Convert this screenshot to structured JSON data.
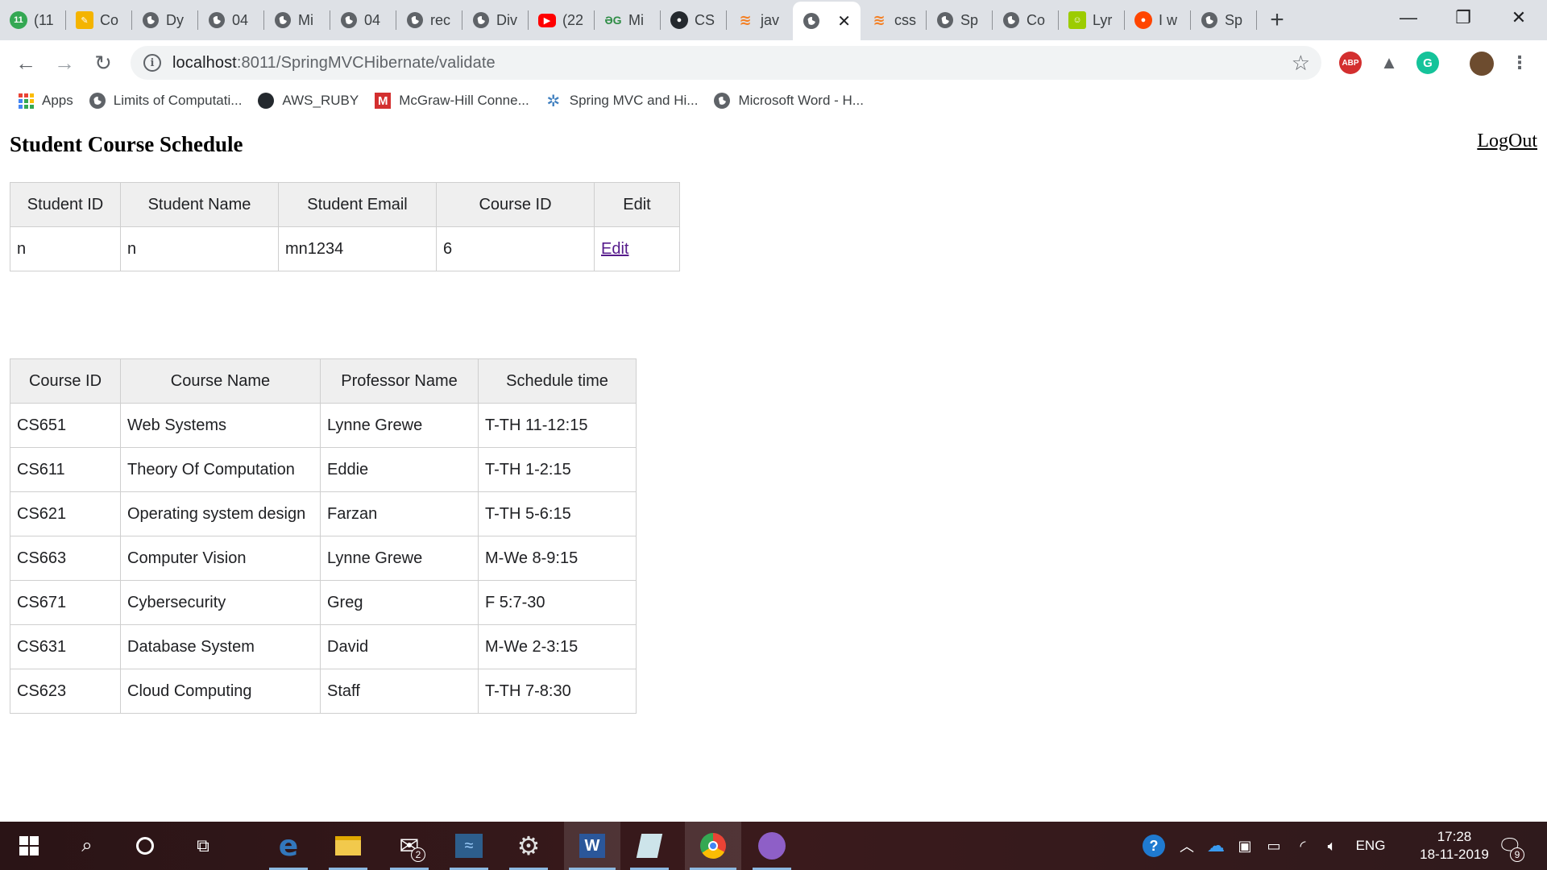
{
  "browser": {
    "tabs": [
      {
        "label": "(11",
        "icon": "counter-icon",
        "color": "#34a853"
      },
      {
        "label": "Co",
        "icon": "pencil-icon",
        "color": "#f4b400"
      },
      {
        "label": "Dy",
        "icon": "globe-icon",
        "color": "#5f6368"
      },
      {
        "label": "04",
        "icon": "globe-icon",
        "color": "#5f6368"
      },
      {
        "label": "Mi",
        "icon": "globe-icon",
        "color": "#5f6368"
      },
      {
        "label": "04",
        "icon": "globe-icon",
        "color": "#5f6368"
      },
      {
        "label": "rec",
        "icon": "globe-icon",
        "color": "#5f6368"
      },
      {
        "label": "Div",
        "icon": "globe-icon",
        "color": "#5f6368"
      },
      {
        "label": "(22",
        "icon": "youtube-icon",
        "color": "#ff0000"
      },
      {
        "label": "Mi",
        "icon": "gfg-icon",
        "color": "#2f8d46"
      },
      {
        "label": "CS",
        "icon": "github-icon",
        "color": "#24292e"
      },
      {
        "label": "jav",
        "icon": "stackoverflow-icon",
        "color": "#f48024"
      },
      {
        "label": "",
        "icon": "globe-icon",
        "color": "#5f6368",
        "active": true
      },
      {
        "label": "css",
        "icon": "stackoverflow-icon",
        "color": "#f48024"
      },
      {
        "label": "Sp",
        "icon": "globe-icon",
        "color": "#5f6368"
      },
      {
        "label": "Co",
        "icon": "globe-icon",
        "color": "#5f6368"
      },
      {
        "label": "Lyr",
        "icon": "lyrics-icon",
        "color": "#9ccc00"
      },
      {
        "label": "I w",
        "icon": "reddit-icon",
        "color": "#ff4500"
      },
      {
        "label": "Sp",
        "icon": "globe-icon",
        "color": "#5f6368"
      }
    ],
    "url_host": "localhost",
    "url_path": ":8011/SpringMVCHibernate/validate",
    "bookmarks": [
      {
        "label": "Apps",
        "icon": "apps-grid-icon"
      },
      {
        "label": "Limits of Computati...",
        "icon": "globe-icon"
      },
      {
        "label": "AWS_RUBY",
        "icon": "github-icon"
      },
      {
        "label": "McGraw-Hill Conne...",
        "icon": "mcgraw-hill-icon"
      },
      {
        "label": "Spring MVC and Hi...",
        "icon": "spring-icon"
      },
      {
        "label": "Microsoft Word - H...",
        "icon": "globe-icon"
      }
    ],
    "extensions": {
      "adblock_label": "ABP",
      "grammarly_label": "G"
    }
  },
  "page": {
    "title": "Student Course Schedule",
    "logout_label": "LogOut",
    "student_table": {
      "headers": [
        "Student ID",
        "Student Name",
        "Student Email",
        "Course ID",
        "Edit"
      ],
      "rows": [
        {
          "id": "n",
          "name": "n",
          "email": "mn1234",
          "course_id": "6",
          "edit": "Edit"
        }
      ]
    },
    "course_table": {
      "headers": [
        "Course ID",
        "Course Name",
        "Professor Name",
        "Schedule time"
      ],
      "rows": [
        {
          "id": "CS651",
          "name": "Web Systems",
          "professor": "Lynne Grewe",
          "time": "T-TH 11-12:15"
        },
        {
          "id": "CS611",
          "name": "Theory Of Computation",
          "professor": "Eddie",
          "time": "T-TH 1-2:15"
        },
        {
          "id": "CS621",
          "name": "Operating system design",
          "professor": "Farzan",
          "time": "T-TH 5-6:15"
        },
        {
          "id": "CS663",
          "name": "Computer Vision",
          "professor": "Lynne Grewe",
          "time": "M-We 8-9:15"
        },
        {
          "id": "CS671",
          "name": "Cybersecurity",
          "professor": "Greg",
          "time": "F 5:7-30"
        },
        {
          "id": "CS631",
          "name": "Database System",
          "professor": "David",
          "time": "M-We 2-3:15"
        },
        {
          "id": "CS623",
          "name": "Cloud Computing",
          "professor": "Staff",
          "time": "T-TH 7-8:30"
        }
      ]
    }
  },
  "taskbar": {
    "mail_badge": "2",
    "language": "ENG",
    "time": "17:28",
    "date": "18-11-2019",
    "notification_count": "9"
  }
}
